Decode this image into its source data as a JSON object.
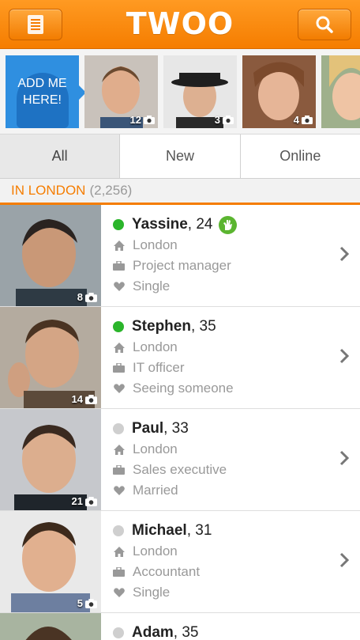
{
  "header": {
    "logo": "TWOO",
    "menu_icon": "menu-icon",
    "search_icon": "search-icon",
    "brand_color": "#f57d00"
  },
  "strip": {
    "add_me_line1": "ADD ME",
    "add_me_line2": "HERE!",
    "photo_counts": [
      "12",
      "3",
      "4"
    ]
  },
  "tabs": [
    {
      "label": "All"
    },
    {
      "label": "New"
    },
    {
      "label": "Online"
    }
  ],
  "section": {
    "city": "IN LONDON",
    "count": "(2,256)"
  },
  "people": [
    {
      "name": "Yassine",
      "age": ", 24",
      "online": true,
      "verified": true,
      "location": "London",
      "job": "Project manager",
      "status": "Single",
      "photos": "8"
    },
    {
      "name": "Stephen",
      "age": ", 35",
      "online": true,
      "verified": false,
      "location": "London",
      "job": "IT officer",
      "status": "Seeing someone",
      "photos": "14"
    },
    {
      "name": "Paul",
      "age": ", 33",
      "online": false,
      "verified": false,
      "location": "London",
      "job": "Sales executive",
      "status": "Married",
      "photos": "21"
    },
    {
      "name": "Michael",
      "age": ", 31",
      "online": false,
      "verified": false,
      "location": "London",
      "job": "Accountant",
      "status": "Single",
      "photos": "5"
    },
    {
      "name": "Adam",
      "age": ", 35",
      "online": false,
      "verified": false
    }
  ],
  "colors": {
    "online": "#2bb52b",
    "offline": "#cfcfcf",
    "verified_badge": "#5bb530"
  }
}
